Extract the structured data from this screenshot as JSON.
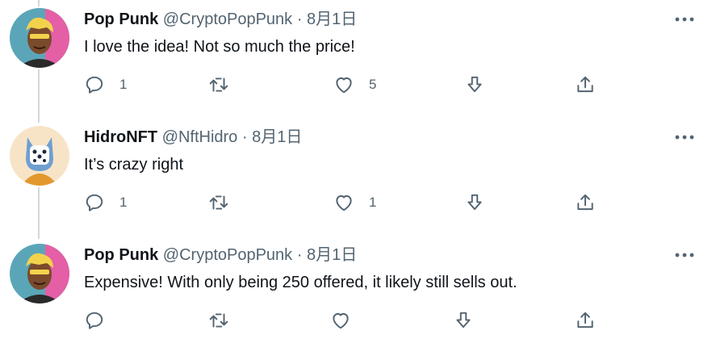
{
  "tweets": [
    {
      "name": "Pop Punk",
      "handle": "@CryptoPopPunk",
      "separator": "·",
      "date": "8月1日",
      "text": "I love the idea! Not so much the price!",
      "reply_count": "1",
      "retweet_count": "",
      "like_count": "5",
      "avatar_icon": "pop-punk-avatar"
    },
    {
      "name": "HidroNFT",
      "handle": "@NftHidro",
      "separator": "·",
      "date": "8月1日",
      "text": "It’s crazy right",
      "reply_count": "1",
      "retweet_count": "",
      "like_count": "1",
      "avatar_icon": "hidro-nft-avatar"
    },
    {
      "name": "Pop Punk",
      "handle": "@CryptoPopPunk",
      "separator": "·",
      "date": "8月1日",
      "text": "Expensive! With only being 250 offered, it likely still sells out.",
      "reply_count": "",
      "retweet_count": "",
      "like_count": "",
      "avatar_icon": "pop-punk-avatar"
    }
  ],
  "colors": {
    "text_primary": "#0f1419",
    "text_secondary": "#536471",
    "thread_line": "#cfd9de"
  }
}
